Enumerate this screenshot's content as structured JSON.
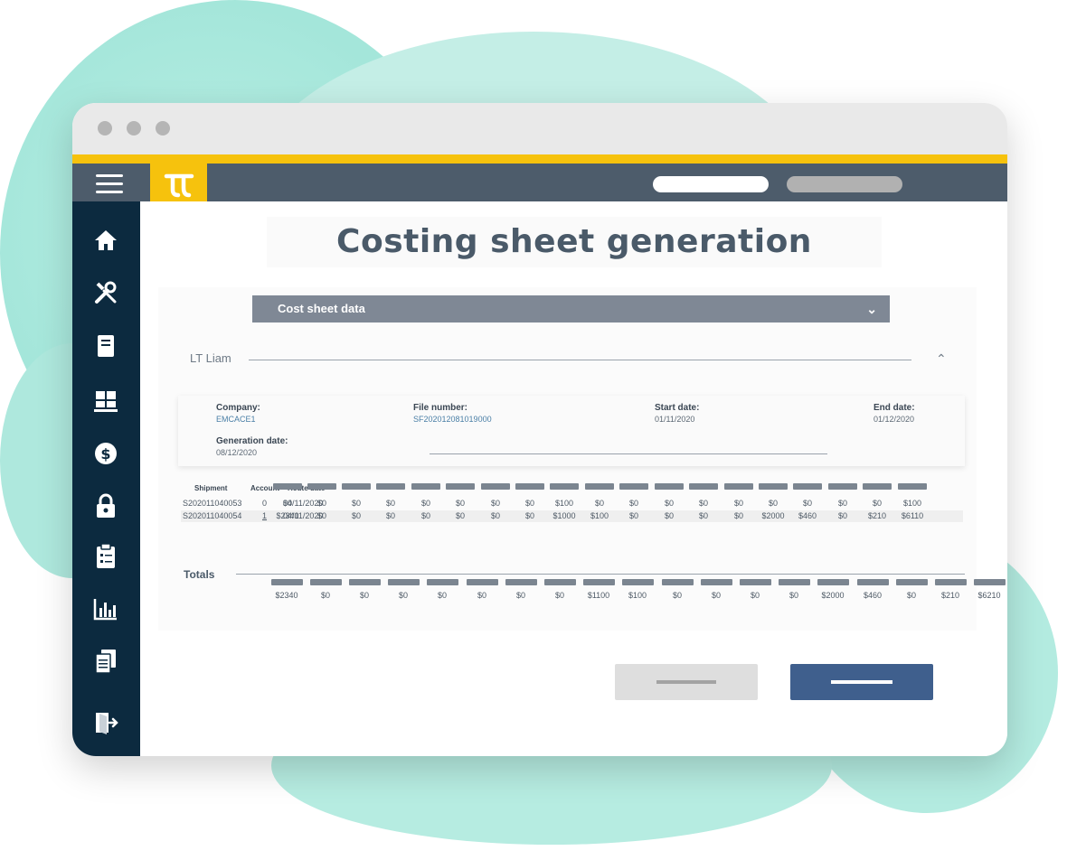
{
  "page": {
    "title": "Costing sheet generation"
  },
  "colors": {
    "accent_yellow": "#f6c20d",
    "topbar": "#4d5c6b",
    "sidebar": "#0c2a3f",
    "primary_button": "#3f5f8d",
    "background_blob": "#aee8dd"
  },
  "sidebar": {
    "items": [
      {
        "icon": "home-icon"
      },
      {
        "icon": "tools-icon"
      },
      {
        "icon": "book-icon"
      },
      {
        "icon": "pallet-boxes-icon"
      },
      {
        "icon": "dollar-icon"
      },
      {
        "icon": "lock-icon"
      },
      {
        "icon": "clipboard-icon"
      },
      {
        "icon": "bar-chart-icon"
      },
      {
        "icon": "documents-icon"
      },
      {
        "icon": "logout-icon"
      }
    ]
  },
  "dropdown": {
    "label": "Cost sheet data",
    "chevron": "⌄"
  },
  "section": {
    "name": "LT Liam",
    "collapse_icon": "⌃"
  },
  "info": {
    "company_label": "Company:",
    "company_value": "EMCACE1",
    "file_label": "File number:",
    "file_value": "SF202012081019000",
    "start_label": "Start date:",
    "start_value": "01/11/2020",
    "end_label": "End date:",
    "end_value": "01/12/2020",
    "generation_label": "Generation date:",
    "generation_value": "08/12/2020"
  },
  "table": {
    "headers": [
      "Shipment",
      "Account",
      "Route date"
    ],
    "rows": [
      {
        "shipment": "S202011040053",
        "account": "0",
        "route_date": "04/11/2020",
        "values": [
          "$0",
          "$0",
          "$0",
          "$0",
          "$0",
          "$0",
          "$0",
          "$0",
          "$100",
          "$0",
          "$0",
          "$0",
          "$0",
          "$0",
          "$0",
          "$0",
          "$0",
          "$0",
          "$100"
        ]
      },
      {
        "shipment": "S202011040054",
        "account": "1",
        "route_date": "04/11/2020",
        "values": [
          "$2340",
          "$0",
          "$0",
          "$0",
          "$0",
          "$0",
          "$0",
          "$0",
          "$1000",
          "$100",
          "$0",
          "$0",
          "$0",
          "$0",
          "$2000",
          "$460",
          "$0",
          "$210",
          "$6110"
        ]
      }
    ]
  },
  "totals": {
    "label": "Totals",
    "values": [
      "$2340",
      "$0",
      "$0",
      "$0",
      "$0",
      "$0",
      "$0",
      "$0",
      "$1100",
      "$100",
      "$0",
      "$0",
      "$0",
      "$0",
      "$2000",
      "$460",
      "$0",
      "$210",
      "$6210"
    ]
  },
  "actions": {
    "secondary": "placeholder-bar",
    "primary": "placeholder-bar"
  }
}
